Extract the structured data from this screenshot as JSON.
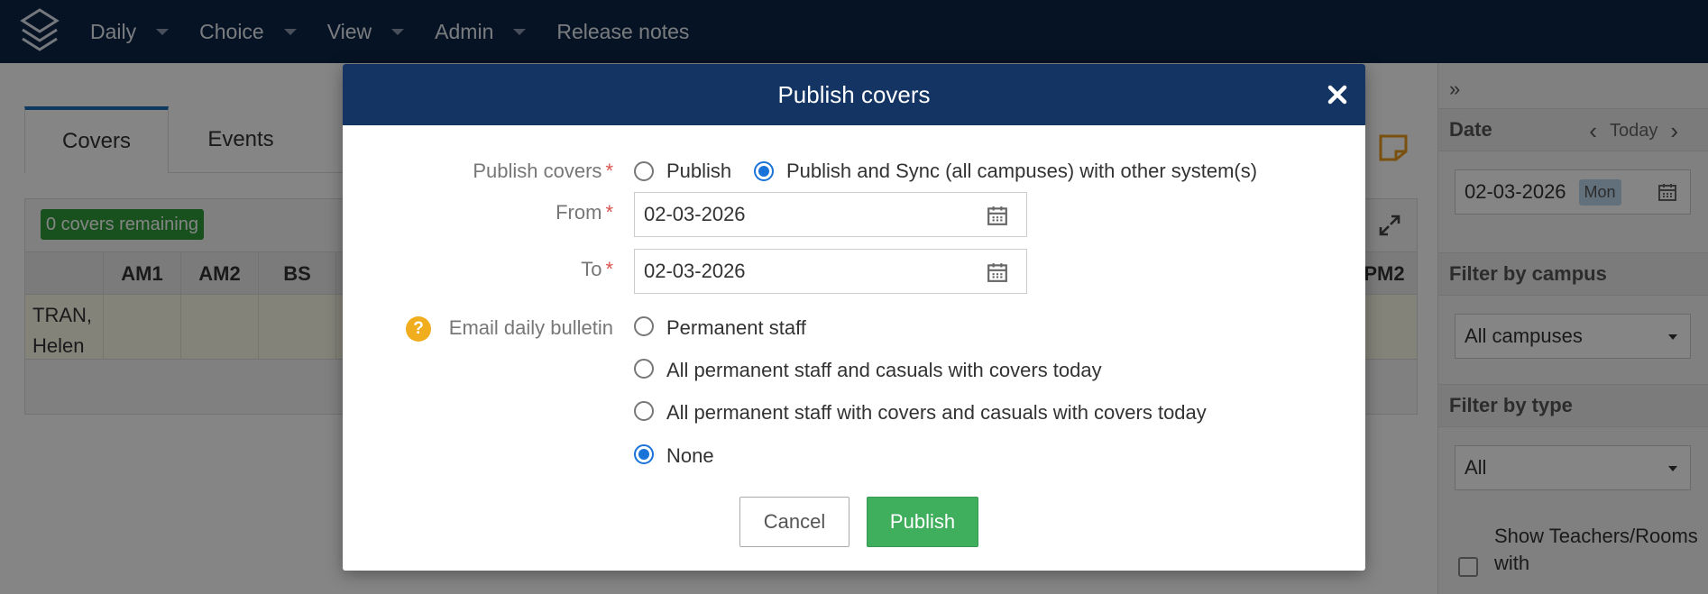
{
  "nav": {
    "items": [
      {
        "label": "Daily",
        "dropdown": true
      },
      {
        "label": "Choice",
        "dropdown": true
      },
      {
        "label": "View",
        "dropdown": true
      },
      {
        "label": "Admin",
        "dropdown": true
      },
      {
        "label": "Release notes",
        "dropdown": false
      }
    ]
  },
  "background": {
    "tabs": [
      "Covers",
      "Events"
    ],
    "active_tab": "Covers",
    "covers_remaining": "0 covers remaining",
    "columns": [
      "AM1",
      "AM2",
      "BS",
      "PM2"
    ],
    "rows": [
      {
        "name_line1": "TRAN,",
        "name_line2": "Helen"
      }
    ]
  },
  "sidebar": {
    "date_label": "Date",
    "today_label": "Today",
    "date_value": "02-03-2026",
    "day_badge": "Mon",
    "campus_label": "Filter by campus",
    "campus_value": "All campuses",
    "type_label": "Filter by type",
    "type_value": "All",
    "show_label": "Show Teachers/Rooms with"
  },
  "modal": {
    "title": "Publish covers",
    "publish_label": "Publish covers",
    "publish_options": [
      "Publish",
      "Publish and Sync (all campuses) with other system(s)"
    ],
    "publish_selected": 1,
    "from_label": "From",
    "from_value": "02-03-2026",
    "to_label": "To",
    "to_value": "02-03-2026",
    "bulletin_label": "Email daily bulletin",
    "bulletin_options": [
      "Permanent staff",
      "All permanent staff and casuals with covers today",
      "All permanent staff with covers and casuals with covers today",
      "None"
    ],
    "bulletin_selected": 3,
    "cancel_label": "Cancel",
    "submit_label": "Publish"
  },
  "colors": {
    "nav_bg": "#0d2545",
    "modal_header": "#143564",
    "publish_button": "#3fae5d",
    "radio_selected": "#1a73d9",
    "badge_green": "#2e9b3a",
    "help_icon": "#f0ad1e"
  }
}
